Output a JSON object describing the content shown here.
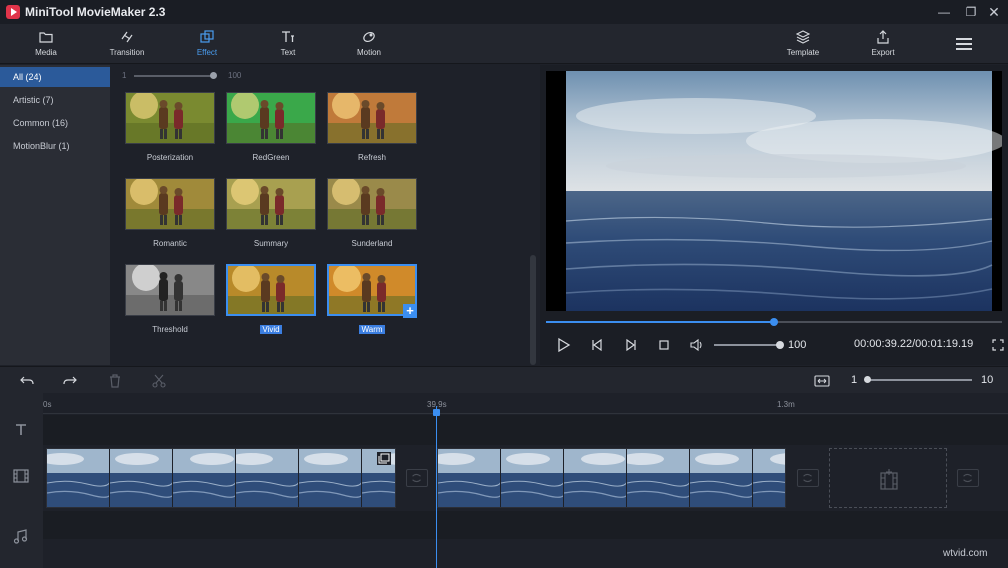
{
  "window": {
    "title": "MiniTool MovieMaker 2.3",
    "controls": [
      "minimize",
      "restore",
      "close"
    ]
  },
  "toolbar": {
    "items": [
      {
        "label": "Media",
        "icon": "folder-icon"
      },
      {
        "label": "Transition",
        "icon": "transition-icon"
      },
      {
        "label": "Effect",
        "icon": "effect-icon",
        "active": true
      },
      {
        "label": "Text",
        "icon": "text-icon"
      },
      {
        "label": "Motion",
        "icon": "motion-icon"
      }
    ],
    "right_items": [
      {
        "label": "Template",
        "icon": "layers-icon"
      },
      {
        "label": "Export",
        "icon": "export-icon"
      }
    ],
    "menu_icon": "hamburger-icon"
  },
  "sidebar": {
    "items": [
      {
        "label": "All",
        "count": "(24)",
        "active": true
      },
      {
        "label": "Artistic",
        "count": "(7)"
      },
      {
        "label": "Common",
        "count": "(16)"
      },
      {
        "label": "MotionBlur",
        "count": "(1)"
      }
    ]
  },
  "effects": {
    "slider_min": "1",
    "slider_max": "100",
    "items": [
      {
        "label": "Posterization",
        "tint": "#7a8a30"
      },
      {
        "label": "RedGreen",
        "tint": "#3aa84a"
      },
      {
        "label": "Refresh",
        "tint": "#c07a3a"
      },
      {
        "label": "Romantic",
        "tint": "#a08a3a"
      },
      {
        "label": "Summary",
        "tint": "#a8a050"
      },
      {
        "label": "Sunderland",
        "tint": "#9a8a4a"
      },
      {
        "label": "Threshold",
        "tint": "#888888"
      },
      {
        "label": "Vivid",
        "tint": "#b88a2a",
        "selected": true
      },
      {
        "label": "Warm",
        "tint": "#d08a2a",
        "selected": true
      }
    ]
  },
  "player": {
    "progress": 0.5,
    "volume": 100,
    "volume_label": "100",
    "timecode": "00:00:39.22/00:01:19.19"
  },
  "timeline": {
    "zoom_min": "1",
    "zoom_max": "10",
    "ruler": [
      "0s",
      "39.9s",
      "1.3m"
    ],
    "watermark": "wtvid.com"
  }
}
